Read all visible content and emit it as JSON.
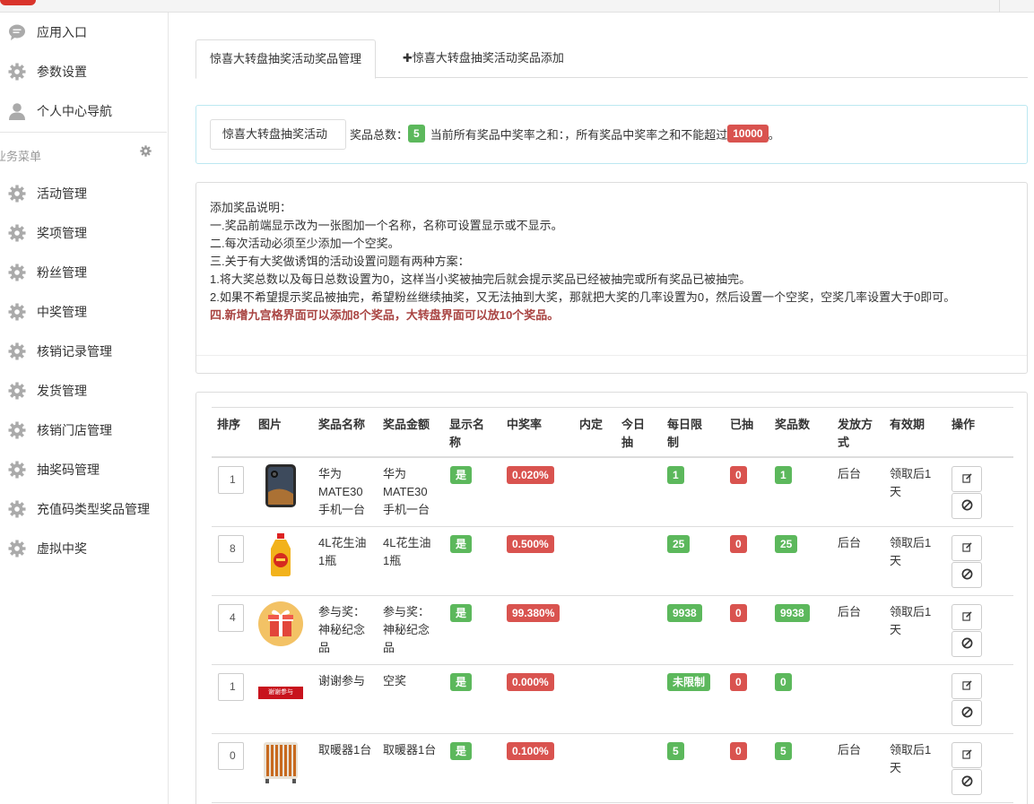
{
  "sidebar": {
    "top_items": [
      {
        "label": "应用入口",
        "icon": "message-icon"
      },
      {
        "label": "参数设置",
        "icon": "gear-icon"
      },
      {
        "label": "个人中心导航",
        "icon": "user-icon"
      }
    ],
    "section_title": "业务菜单",
    "items": [
      {
        "label": "活动管理"
      },
      {
        "label": "奖项管理"
      },
      {
        "label": "粉丝管理"
      },
      {
        "label": "中奖管理"
      },
      {
        "label": "核销记录管理"
      },
      {
        "label": "发货管理"
      },
      {
        "label": "核销门店管理"
      },
      {
        "label": "抽奖码管理"
      },
      {
        "label": "充值码类型奖品管理"
      },
      {
        "label": "虚拟中奖"
      }
    ]
  },
  "tabs": {
    "manage": "惊喜大转盘抽奖活动奖品管理",
    "add": "✚惊喜大转盘抽奖活动奖品添加"
  },
  "info": {
    "activity_button": "惊喜大转盘抽奖活动",
    "total_label": "奖品总数：",
    "total_count": "5",
    "rate_text": "当前所有奖品中奖率之和：，所有奖品中奖率之和不能超过",
    "max_rate": "10000",
    "end": "。"
  },
  "notes": {
    "lines": [
      "添加奖品说明：",
      "一.奖品前端显示改为一张图加一个名称，名称可设置显示或不显示。",
      "二.每次活动必须至少添加一个空奖。",
      "三.关于有大奖做诱饵的活动设置问题有两种方案：",
      "1.将大奖总数以及每日总数设置为0，这样当小奖被抽完后就会提示奖品已经被抽完或所有奖品已被抽完。",
      "2.如果不希望提示奖品被抽完，希望粉丝继续抽奖，又无法抽到大奖，那就把大奖的几率设置为0，然后设置一个空奖，空奖几率设置大于0即可。"
    ],
    "highlight": "四.新增九宫格界面可以添加8个奖品，大转盘界面可以放10个奖品。"
  },
  "table": {
    "headers": {
      "sort": "排序",
      "image": "图片",
      "name": "奖品名称",
      "amount": "奖品金额",
      "show_name": "显示名称",
      "rate": "中奖率",
      "internal": "内定",
      "today": "今日抽",
      "daily_limit": "每日限制",
      "drawn": "已抽",
      "count": "奖品数",
      "delivery": "发放方式",
      "validity": "有效期",
      "actions": "操作"
    },
    "rows": [
      {
        "sort": "1",
        "image": "phone-image",
        "name": "华为MATE30手机一台",
        "amount": "华为MATE30手机一台",
        "show_name": "是",
        "rate": "0.020%",
        "daily_limit": "1",
        "drawn": "0",
        "count": "1",
        "delivery": "后台",
        "validity": "领取后1天"
      },
      {
        "sort": "8",
        "image": "oil-bottle-image",
        "name": "4L花生油1瓶",
        "amount": "4L花生油1瓶",
        "show_name": "是",
        "rate": "0.500%",
        "daily_limit": "25",
        "drawn": "0",
        "count": "25",
        "delivery": "后台",
        "validity": "领取后1天"
      },
      {
        "sort": "4",
        "image": "gift-box-image",
        "name": "参与奖：神秘纪念品",
        "amount": "参与奖：神秘纪念品",
        "show_name": "是",
        "rate": "99.380%",
        "daily_limit": "9938",
        "drawn": "0",
        "count": "9938",
        "delivery": "后台",
        "validity": "领取后1天"
      },
      {
        "sort": "1",
        "image": "thanks-banner-image",
        "name": "谢谢参与",
        "amount": "空奖",
        "show_name": "是",
        "rate": "0.000%",
        "daily_limit": "未限制",
        "drawn": "0",
        "count": "0",
        "delivery": "",
        "validity": ""
      },
      {
        "sort": "0",
        "image": "heater-image",
        "name": "取暖器1台",
        "amount": "取暖器1台",
        "show_name": "是",
        "rate": "0.100%",
        "daily_limit": "5",
        "drawn": "0",
        "count": "5",
        "delivery": "后台",
        "validity": "领取后1天"
      }
    ],
    "thanks_banner_text": "谢谢参与"
  },
  "colors": {
    "green": "#5cb85c",
    "red": "#d9534f",
    "highlight": "#a94442",
    "info_border": "#bce8f1"
  }
}
